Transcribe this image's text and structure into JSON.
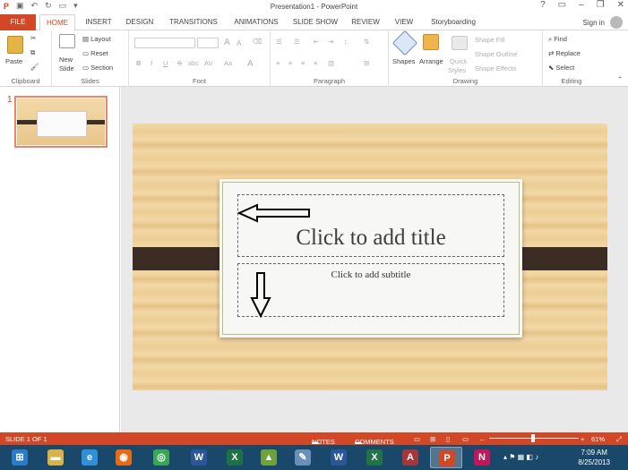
{
  "window": {
    "title": "Presentation1 - PowerPoint",
    "signin": "Sign in",
    "help": "?",
    "minimize": "–",
    "restore": "❐",
    "close": "✕"
  },
  "tabs": [
    {
      "label": "FILE"
    },
    {
      "label": "HOME"
    },
    {
      "label": "INSERT"
    },
    {
      "label": "DESIGN"
    },
    {
      "label": "TRANSITIONS"
    },
    {
      "label": "ANIMATIONS"
    },
    {
      "label": "SLIDE SHOW"
    },
    {
      "label": "REVIEW"
    },
    {
      "label": "VIEW"
    },
    {
      "label": "Storyboarding"
    }
  ],
  "ribbon": {
    "clipboard": {
      "paste": "Paste",
      "label": "Clipboard"
    },
    "slides": {
      "new_slide_line1": "New",
      "new_slide_line2": "Slide",
      "layout": "Layout",
      "reset": "Reset",
      "section": "Section",
      "label": "Slides"
    },
    "font": {
      "label": "Font",
      "bold": "B",
      "italic": "I",
      "underline": "U",
      "strike": "S",
      "shadow": "abc",
      "spacing": "AV",
      "case": "Aa",
      "color": "A",
      "grow": "A",
      "shrink": "A"
    },
    "paragraph": {
      "label": "Paragraph"
    },
    "drawing": {
      "shapes": "Shapes",
      "arrange": "Arrange",
      "quick_line1": "Quick",
      "quick_line2": "Styles",
      "shape_fill": "Shape Fill",
      "shape_outline": "Shape Outline",
      "shape_effects": "Shape Effects",
      "label": "Drawing"
    },
    "editing": {
      "find": "Find",
      "replace": "Replace",
      "select": "Select",
      "label": "Editing"
    }
  },
  "thumbnails": [
    {
      "number": "1"
    }
  ],
  "slide": {
    "title_placeholder": "Click to add title",
    "subtitle_placeholder": "Click to add subtitle"
  },
  "status": {
    "slide_count": "SLIDE 1 OF 1",
    "notes": "NOTES",
    "comments": "COMMENTS",
    "zoom": "61%",
    "zoom_out": "–",
    "zoom_in": "+"
  },
  "taskbar": {
    "time": "7:09 AM",
    "date": "8/25/2013",
    "apps": [
      {
        "name": "start",
        "glyph": "⊞",
        "color": "#2a7cc7"
      },
      {
        "name": "explorer",
        "glyph": "▬",
        "color": "#d8b24a"
      },
      {
        "name": "internet-explorer",
        "glyph": "e",
        "color": "#2f8fd8"
      },
      {
        "name": "firefox",
        "glyph": "◉",
        "color": "#e66b16"
      },
      {
        "name": "chrome",
        "glyph": "◎",
        "color": "#3aa757"
      },
      {
        "name": "word-2010",
        "glyph": "W",
        "color": "#2b5797"
      },
      {
        "name": "excel-2010",
        "glyph": "X",
        "color": "#1e7145"
      },
      {
        "name": "image-viewer",
        "glyph": "▲",
        "color": "#6ea23c"
      },
      {
        "name": "paint",
        "glyph": "✎",
        "color": "#6a8fb8"
      },
      {
        "name": "word-2013",
        "glyph": "W",
        "color": "#2b579a"
      },
      {
        "name": "excel-2013",
        "glyph": "X",
        "color": "#217346"
      },
      {
        "name": "access-2013",
        "glyph": "A",
        "color": "#a4373a"
      },
      {
        "name": "powerpoint-2013",
        "glyph": "P",
        "color": "#d24726"
      },
      {
        "name": "onenote",
        "glyph": "N",
        "color": "#c2185b"
      }
    ]
  }
}
